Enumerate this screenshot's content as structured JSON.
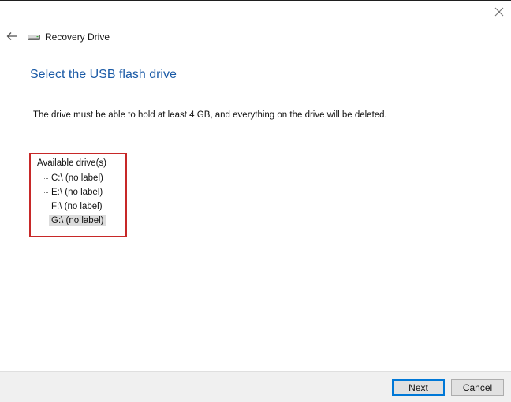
{
  "window": {
    "close_icon": "close-icon"
  },
  "header": {
    "back_icon": "back-arrow-icon",
    "app_icon": "drive-icon",
    "app_title": "Recovery Drive"
  },
  "main": {
    "title": "Select the USB flash drive",
    "instruction": "The drive must be able to hold at least 4 GB, and everything on the drive will be deleted.",
    "drives": {
      "root_label": "Available drive(s)",
      "items": [
        {
          "label": "C:\\ (no label)",
          "selected": false
        },
        {
          "label": "E:\\ (no label)",
          "selected": false
        },
        {
          "label": "F:\\ (no label)",
          "selected": false
        },
        {
          "label": "G:\\ (no label)",
          "selected": true
        }
      ]
    },
    "highlight_color": "#c72828",
    "title_color": "#1a5aa6"
  },
  "footer": {
    "next_label": "Next",
    "cancel_label": "Cancel"
  }
}
